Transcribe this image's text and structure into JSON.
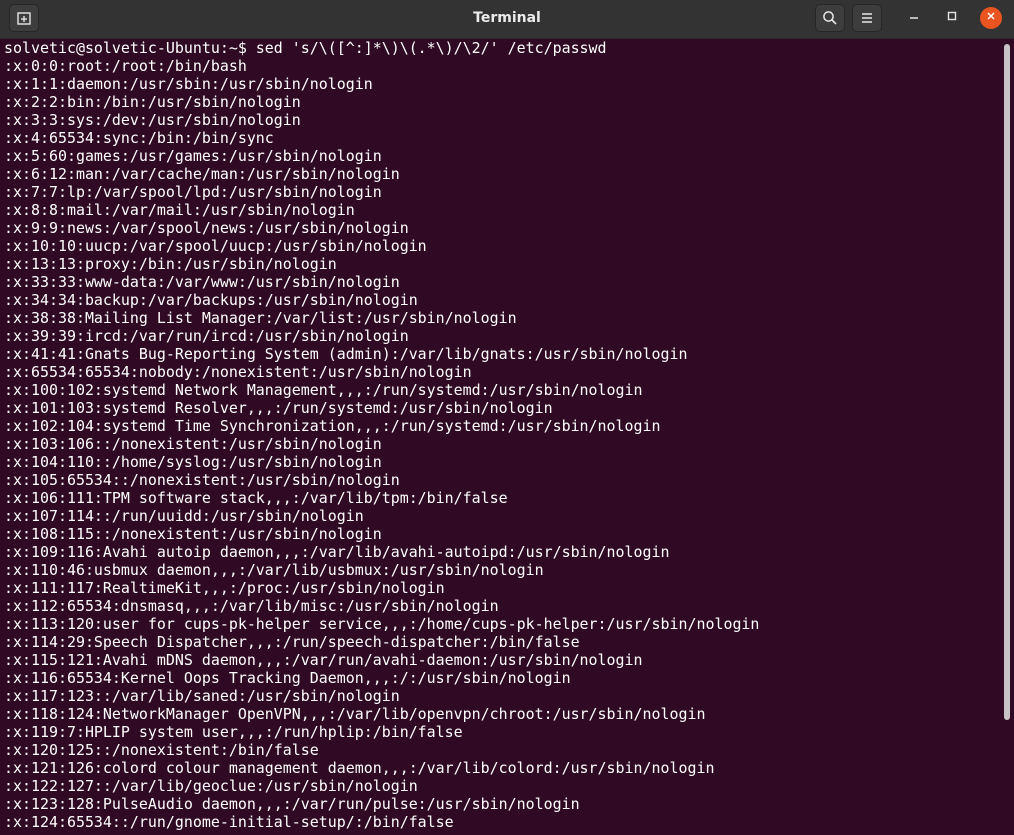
{
  "window": {
    "title": "Terminal"
  },
  "icons": {
    "new_tab": "new-tab-icon",
    "search": "search-icon",
    "menu": "hamburger-menu-icon",
    "minimize": "minimize-icon",
    "maximize": "maximize-icon",
    "close": "close-icon"
  },
  "colors": {
    "terminal_background": "#300a24",
    "titlebar_background": "#333333",
    "close_button": "#e95420",
    "text": "#ffffff"
  },
  "terminal": {
    "lines": [
      "solvetic@solvetic-Ubuntu:~$ sed 's/\\([^:]*\\)\\(.*\\)/\\2/' /etc/passwd",
      ":x:0:0:root:/root:/bin/bash",
      ":x:1:1:daemon:/usr/sbin:/usr/sbin/nologin",
      ":x:2:2:bin:/bin:/usr/sbin/nologin",
      ":x:3:3:sys:/dev:/usr/sbin/nologin",
      ":x:4:65534:sync:/bin:/bin/sync",
      ":x:5:60:games:/usr/games:/usr/sbin/nologin",
      ":x:6:12:man:/var/cache/man:/usr/sbin/nologin",
      ":x:7:7:lp:/var/spool/lpd:/usr/sbin/nologin",
      ":x:8:8:mail:/var/mail:/usr/sbin/nologin",
      ":x:9:9:news:/var/spool/news:/usr/sbin/nologin",
      ":x:10:10:uucp:/var/spool/uucp:/usr/sbin/nologin",
      ":x:13:13:proxy:/bin:/usr/sbin/nologin",
      ":x:33:33:www-data:/var/www:/usr/sbin/nologin",
      ":x:34:34:backup:/var/backups:/usr/sbin/nologin",
      ":x:38:38:Mailing List Manager:/var/list:/usr/sbin/nologin",
      ":x:39:39:ircd:/var/run/ircd:/usr/sbin/nologin",
      ":x:41:41:Gnats Bug-Reporting System (admin):/var/lib/gnats:/usr/sbin/nologin",
      ":x:65534:65534:nobody:/nonexistent:/usr/sbin/nologin",
      ":x:100:102:systemd Network Management,,,:/run/systemd:/usr/sbin/nologin",
      ":x:101:103:systemd Resolver,,,:/run/systemd:/usr/sbin/nologin",
      ":x:102:104:systemd Time Synchronization,,,:/run/systemd:/usr/sbin/nologin",
      ":x:103:106::/nonexistent:/usr/sbin/nologin",
      ":x:104:110::/home/syslog:/usr/sbin/nologin",
      ":x:105:65534::/nonexistent:/usr/sbin/nologin",
      ":x:106:111:TPM software stack,,,:/var/lib/tpm:/bin/false",
      ":x:107:114::/run/uuidd:/usr/sbin/nologin",
      ":x:108:115::/nonexistent:/usr/sbin/nologin",
      ":x:109:116:Avahi autoip daemon,,,:/var/lib/avahi-autoipd:/usr/sbin/nologin",
      ":x:110:46:usbmux daemon,,,:/var/lib/usbmux:/usr/sbin/nologin",
      ":x:111:117:RealtimeKit,,,:/proc:/usr/sbin/nologin",
      ":x:112:65534:dnsmasq,,,:/var/lib/misc:/usr/sbin/nologin",
      ":x:113:120:user for cups-pk-helper service,,,:/home/cups-pk-helper:/usr/sbin/nologin",
      ":x:114:29:Speech Dispatcher,,,:/run/speech-dispatcher:/bin/false",
      ":x:115:121:Avahi mDNS daemon,,,:/var/run/avahi-daemon:/usr/sbin/nologin",
      ":x:116:65534:Kernel Oops Tracking Daemon,,,:/:/usr/sbin/nologin",
      ":x:117:123::/var/lib/saned:/usr/sbin/nologin",
      ":x:118:124:NetworkManager OpenVPN,,,:/var/lib/openvpn/chroot:/usr/sbin/nologin",
      ":x:119:7:HPLIP system user,,,:/run/hplip:/bin/false",
      ":x:120:125::/nonexistent:/bin/false",
      ":x:121:126:colord colour management daemon,,,:/var/lib/colord:/usr/sbin/nologin",
      ":x:122:127::/var/lib/geoclue:/usr/sbin/nologin",
      ":x:123:128:PulseAudio daemon,,,:/var/run/pulse:/usr/sbin/nologin",
      ":x:124:65534::/run/gnome-initial-setup/:/bin/false"
    ]
  }
}
